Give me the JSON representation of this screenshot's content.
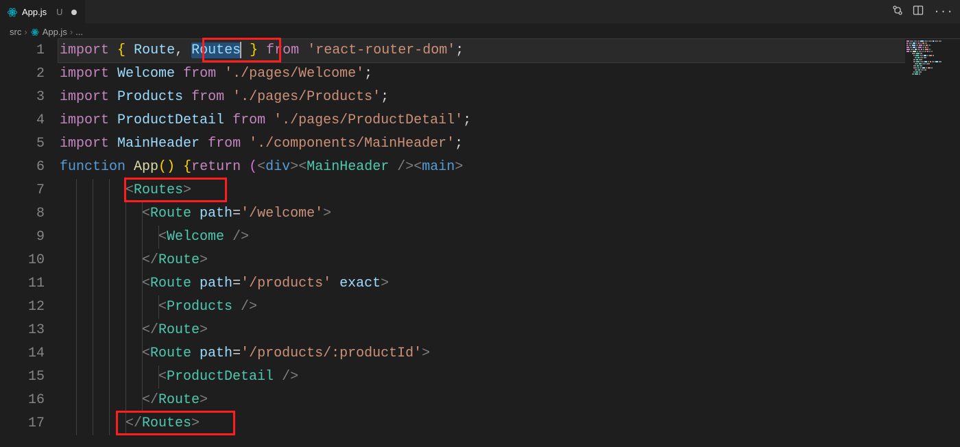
{
  "tab": {
    "filename": "App.js",
    "modified_marker": "U"
  },
  "breadcrumbs": {
    "folder": "src",
    "file": "App.js",
    "trail": "..."
  },
  "colors": {
    "bg": "#1e1e1e",
    "highlight_box": "#ff1e1e",
    "keyword": "#c586c0",
    "function": "#dcdcaa",
    "variable": "#9cdcfe",
    "string": "#ce9178",
    "tag": "#4ec9b0",
    "brace": "#ffd700"
  },
  "code_lines": [
    {
      "n": 1,
      "indent": 0,
      "tokens": [
        [
          "kw",
          "import"
        ],
        [
          "pun",
          " "
        ],
        [
          "brace",
          "{"
        ],
        [
          "pun",
          " "
        ],
        [
          "var",
          "Route"
        ],
        [
          "pun",
          ", "
        ],
        [
          "sel-start",
          ""
        ],
        [
          "var",
          "Routes"
        ],
        [
          "sel-end",
          ""
        ],
        [
          "cursor",
          ""
        ],
        [
          "pun",
          " "
        ],
        [
          "brace",
          "}"
        ],
        [
          "pun",
          " "
        ],
        [
          "kw",
          "from"
        ],
        [
          "pun",
          " "
        ],
        [
          "str",
          "'react-router-dom'"
        ],
        [
          "pun",
          ";"
        ]
      ]
    },
    {
      "n": 2,
      "indent": 0,
      "tokens": [
        [
          "kw",
          "import"
        ],
        [
          "pun",
          " "
        ],
        [
          "var",
          "Welcome"
        ],
        [
          "pun",
          " "
        ],
        [
          "kw",
          "from"
        ],
        [
          "pun",
          " "
        ],
        [
          "str",
          "'./pages/Welcome'"
        ],
        [
          "pun",
          ";"
        ]
      ]
    },
    {
      "n": 3,
      "indent": 0,
      "tokens": [
        [
          "kw",
          "import"
        ],
        [
          "pun",
          " "
        ],
        [
          "var",
          "Products"
        ],
        [
          "pun",
          " "
        ],
        [
          "kw",
          "from"
        ],
        [
          "pun",
          " "
        ],
        [
          "str",
          "'./pages/Products'"
        ],
        [
          "pun",
          ";"
        ]
      ]
    },
    {
      "n": 4,
      "indent": 0,
      "tokens": [
        [
          "kw",
          "import"
        ],
        [
          "pun",
          " "
        ],
        [
          "var",
          "ProductDetail"
        ],
        [
          "pun",
          " "
        ],
        [
          "kw",
          "from"
        ],
        [
          "pun",
          " "
        ],
        [
          "str",
          "'./pages/ProductDetail'"
        ],
        [
          "pun",
          ";"
        ]
      ]
    },
    {
      "n": 5,
      "indent": 0,
      "tokens": [
        [
          "kw",
          "import"
        ],
        [
          "pun",
          " "
        ],
        [
          "var",
          "MainHeader"
        ],
        [
          "pun",
          " "
        ],
        [
          "kw",
          "from"
        ],
        [
          "pun",
          " "
        ],
        [
          "str",
          "'./components/MainHeader'"
        ],
        [
          "pun",
          ";"
        ]
      ]
    },
    {
      "n": 6,
      "indent": 0,
      "tokens": [
        [
          "fnkw",
          "function"
        ],
        [
          "pun",
          " "
        ],
        [
          "fn",
          "App"
        ],
        [
          "brace",
          "("
        ],
        [
          "brace",
          ")"
        ],
        [
          "pun",
          " "
        ],
        [
          "brace",
          "{"
        ],
        [
          "kw",
          "return"
        ],
        [
          "pun",
          " "
        ],
        [
          "brace2",
          "("
        ],
        [
          "ang",
          "<"
        ],
        [
          "tagb",
          "div"
        ],
        [
          "ang",
          ">"
        ],
        [
          "ang",
          "<"
        ],
        [
          "tag",
          "MainHeader"
        ],
        [
          "pun",
          " "
        ],
        [
          "ang",
          "/>"
        ],
        [
          "ang",
          "<"
        ],
        [
          "tagb",
          "main"
        ],
        [
          "ang",
          ">"
        ]
      ]
    },
    {
      "n": 7,
      "indent": 4,
      "tokens": [
        [
          "ang",
          "<"
        ],
        [
          "tag",
          "Routes"
        ],
        [
          "ang",
          ">"
        ]
      ]
    },
    {
      "n": 8,
      "indent": 5,
      "tokens": [
        [
          "ang",
          "<"
        ],
        [
          "tag",
          "Route"
        ],
        [
          "pun",
          " "
        ],
        [
          "attr",
          "path"
        ],
        [
          "pun",
          "="
        ],
        [
          "str",
          "'/welcome'"
        ],
        [
          "ang",
          ">"
        ]
      ]
    },
    {
      "n": 9,
      "indent": 6,
      "tokens": [
        [
          "ang",
          "<"
        ],
        [
          "tag",
          "Welcome"
        ],
        [
          "pun",
          " "
        ],
        [
          "ang",
          "/>"
        ]
      ]
    },
    {
      "n": 10,
      "indent": 5,
      "tokens": [
        [
          "ang",
          "</"
        ],
        [
          "tag",
          "Route"
        ],
        [
          "ang",
          ">"
        ]
      ]
    },
    {
      "n": 11,
      "indent": 5,
      "tokens": [
        [
          "ang",
          "<"
        ],
        [
          "tag",
          "Route"
        ],
        [
          "pun",
          " "
        ],
        [
          "attr",
          "path"
        ],
        [
          "pun",
          "="
        ],
        [
          "str",
          "'/products'"
        ],
        [
          "pun",
          " "
        ],
        [
          "attr",
          "exact"
        ],
        [
          "ang",
          ">"
        ]
      ]
    },
    {
      "n": 12,
      "indent": 6,
      "tokens": [
        [
          "ang",
          "<"
        ],
        [
          "tag",
          "Products"
        ],
        [
          "pun",
          " "
        ],
        [
          "ang",
          "/>"
        ]
      ]
    },
    {
      "n": 13,
      "indent": 5,
      "tokens": [
        [
          "ang",
          "</"
        ],
        [
          "tag",
          "Route"
        ],
        [
          "ang",
          ">"
        ]
      ]
    },
    {
      "n": 14,
      "indent": 5,
      "tokens": [
        [
          "ang",
          "<"
        ],
        [
          "tag",
          "Route"
        ],
        [
          "pun",
          " "
        ],
        [
          "attr",
          "path"
        ],
        [
          "pun",
          "="
        ],
        [
          "str",
          "'/products/:productId'"
        ],
        [
          "ang",
          ">"
        ]
      ]
    },
    {
      "n": 15,
      "indent": 6,
      "tokens": [
        [
          "ang",
          "<"
        ],
        [
          "tag",
          "ProductDetail"
        ],
        [
          "pun",
          " "
        ],
        [
          "ang",
          "/>"
        ]
      ]
    },
    {
      "n": 16,
      "indent": 5,
      "tokens": [
        [
          "ang",
          "</"
        ],
        [
          "tag",
          "Route"
        ],
        [
          "ang",
          ">"
        ]
      ]
    },
    {
      "n": 17,
      "indent": 4,
      "tokens": [
        [
          "ang",
          "</"
        ],
        [
          "tag",
          "Routes"
        ],
        [
          "ang",
          ">"
        ]
      ]
    }
  ],
  "highlight_boxes": [
    {
      "line": 1,
      "left_ch": 17.5,
      "width_ch": 9.6,
      "note": "Routes in import"
    },
    {
      "line": 7,
      "left_ch": 8,
      "width_ch": 12.5,
      "note": "<Routes> open"
    },
    {
      "line": 17,
      "left_ch": 7,
      "width_ch": 14.5,
      "note": "</Routes> close"
    }
  ]
}
